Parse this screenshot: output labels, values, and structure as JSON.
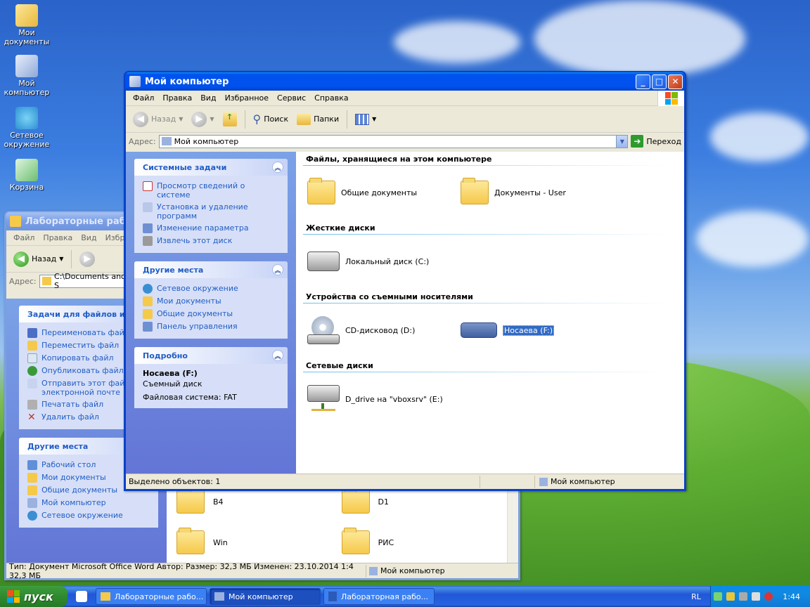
{
  "desktop": {
    "icons": [
      {
        "label": "Мои документы",
        "name": "my-documents-desktop-icon"
      },
      {
        "label": "Мой компьютер",
        "name": "my-computer-desktop-icon"
      },
      {
        "label": "Сетевое окружение",
        "name": "network-desktop-icon"
      },
      {
        "label": "Корзина",
        "name": "recycle-bin-desktop-icon"
      }
    ]
  },
  "back_window": {
    "title": "Лабораторные работы",
    "menu": [
      "Файл",
      "Правка",
      "Вид",
      "Избр"
    ],
    "back_label": "Назад",
    "address_label": "Адрес:",
    "address_value": "C:\\Documents and S",
    "tasks_header": "Задачи для файлов и па",
    "tasks": [
      "Переименовать файл",
      "Переместить файл",
      "Копировать файл",
      "Опубликовать файл в",
      "Отправить этот файл по электронной почте",
      "Печатать файл",
      "Удалить файл"
    ],
    "places_header": "Другие места",
    "places": [
      "Рабочий стол",
      "Мои документы",
      "Общие документы",
      "Мой компьютер",
      "Сетевое окружение"
    ],
    "folders": [
      "B4",
      "D1",
      "Win",
      "РИС"
    ],
    "status": "Тип: Документ Microsoft Office Word Автор: Размер: 32,3 МБ Изменен: 23.10.2014 1:4 32,3 МБ",
    "status_location": "Мой компьютер"
  },
  "front_window": {
    "title": "Мой компьютер",
    "menu": [
      "Файл",
      "Правка",
      "Вид",
      "Избранное",
      "Сервис",
      "Справка"
    ],
    "toolbar": {
      "back": "Назад",
      "search": "Поиск",
      "folders": "Папки"
    },
    "address_label": "Адрес:",
    "address_value": "Мой компьютер",
    "go_label": "Переход",
    "system_tasks": {
      "header": "Системные задачи",
      "items": [
        "Просмотр сведений о системе",
        "Установка и удаление программ",
        "Изменение параметра",
        "Извлечь этот диск"
      ]
    },
    "other_places": {
      "header": "Другие места",
      "items": [
        "Сетевое окружение",
        "Мои документы",
        "Общие документы",
        "Панель управления"
      ]
    },
    "details": {
      "header": "Подробно",
      "name": "Носаева (F:)",
      "type": "Съемный диск",
      "fs": "Файловая система: FAT"
    },
    "groups": [
      {
        "header": "Файлы, хранящиеся на этом компьютере",
        "items": [
          "Общие документы",
          "Документы - User"
        ]
      },
      {
        "header": "Жесткие диски",
        "items": [
          "Локальный диск (C:)"
        ]
      },
      {
        "header": "Устройства со съемными носителями",
        "items": [
          "CD-дисковод (D:)",
          "Носаева (F:)"
        ]
      },
      {
        "header": "Сетевые диски",
        "items": [
          "D_drive на \"vboxsrv\" (E:)"
        ]
      }
    ],
    "status": "Выделено объектов: 1",
    "status_location": "Мой компьютер"
  },
  "taskbar": {
    "start": "пуск",
    "tasks": [
      "Лабораторные рабо...",
      "Мой компьютер",
      "Лабораторная рабо..."
    ],
    "lang": "RL",
    "clock": "1:44"
  }
}
